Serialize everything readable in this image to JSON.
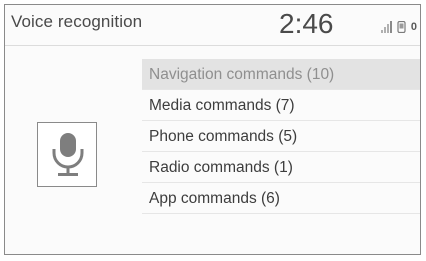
{
  "header": {
    "title": "Voice recognition",
    "time": "2:46",
    "status": {
      "signal_icon": "signal-strength-icon",
      "phone_icon": "phone-icon",
      "extra_glyph": "0"
    }
  },
  "mic": {
    "icon": "microphone-icon"
  },
  "menu": {
    "items": [
      {
        "label": "Navigation commands (10)",
        "selected": true
      },
      {
        "label": "Media commands (7)",
        "selected": false
      },
      {
        "label": "Phone commands (5)",
        "selected": false
      },
      {
        "label": "Radio commands (1)",
        "selected": false
      },
      {
        "label": "App commands (6)",
        "selected": false
      }
    ]
  },
  "colors": {
    "selected_bg": "#e3e3e3",
    "selected_text": "#8f8f8f",
    "text": "#3d3d3d",
    "border": "#8a8a8a"
  }
}
